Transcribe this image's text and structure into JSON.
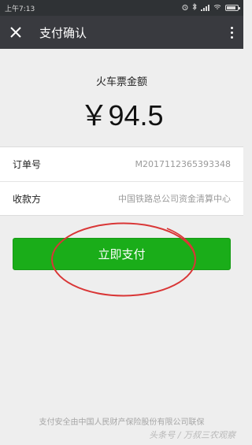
{
  "status_bar": {
    "time": "上午7:13"
  },
  "header": {
    "close_icon": "close-icon",
    "title": "支付确认",
    "menu_icon": "more-vertical-icon"
  },
  "payment": {
    "label": "火车票金额",
    "amount": "￥94.5"
  },
  "details": {
    "order_no_label": "订单号",
    "order_no_value": "M2017112365393348",
    "payee_label": "收款方",
    "payee_value": "中国铁路总公司资金清算中心"
  },
  "pay_button_label": "立即支付",
  "footer_note": "支付安全由中国人民财产保险股份有限公司联保",
  "watermark": "头条号 / 万叔三农观察",
  "colors": {
    "status_bar": "#2f3235",
    "title_bar": "#393a3f",
    "page_background": "#eeeeee",
    "pay_button": "#1aad19",
    "annotation_circle": "#d93636"
  }
}
